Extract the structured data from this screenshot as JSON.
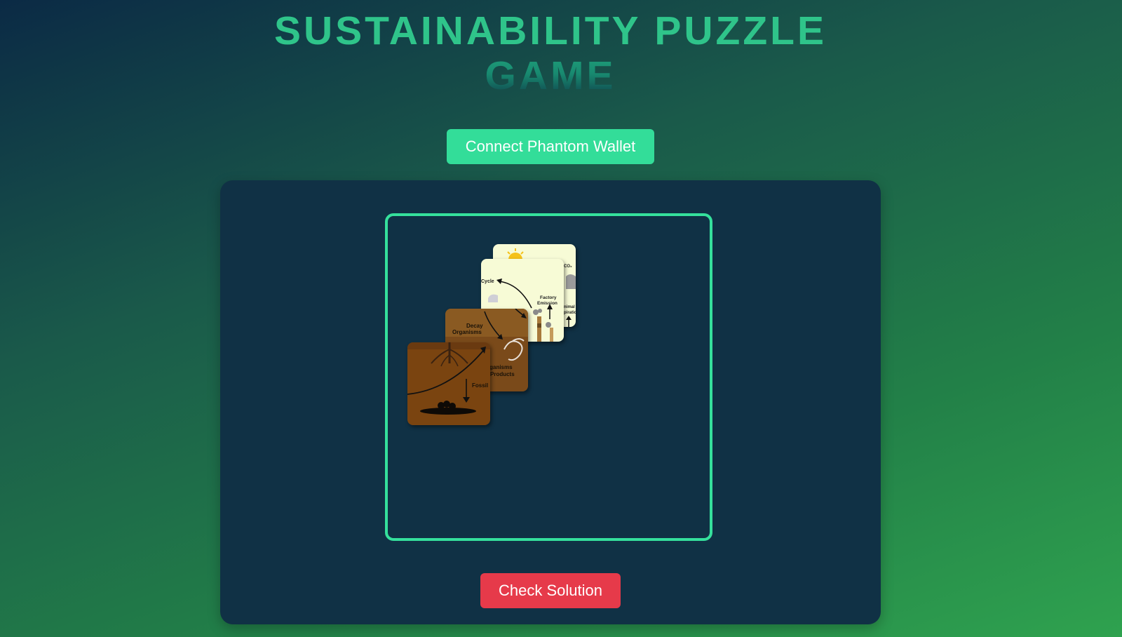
{
  "header": {
    "title_line1": "SUSTAINABILITY PUZZLE",
    "title_line2": "GAME"
  },
  "wallet": {
    "connect_label": "Connect Phantom Wallet"
  },
  "puzzle": {
    "pieces": [
      {
        "name": "sky-corner-piece",
        "labels": [
          "CO₂",
          "nimal",
          "piratio"
        ]
      },
      {
        "name": "factory-piece",
        "labels": [
          "Cycle",
          "Factory",
          "Emission"
        ]
      },
      {
        "name": "decay-piece",
        "labels": [
          "Decay",
          "Organisms",
          "rganisms",
          "Products"
        ]
      },
      {
        "name": "fossil-piece",
        "labels": [
          "Fossil"
        ]
      }
    ]
  },
  "actions": {
    "check_label": "Check Solution"
  },
  "colors": {
    "accent": "#35e09c",
    "panel": "#103145",
    "danger": "#e63a4a"
  }
}
